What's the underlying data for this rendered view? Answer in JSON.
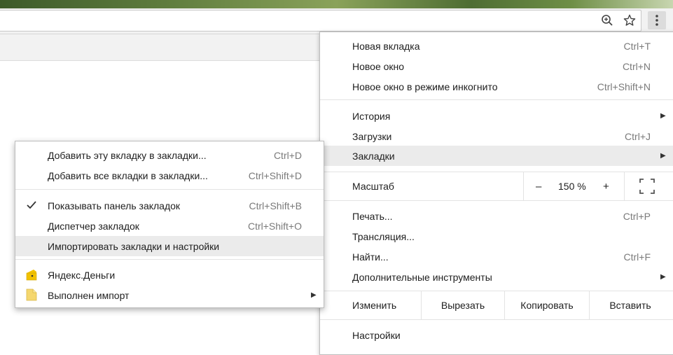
{
  "toolbar": {
    "icons": [
      "zoom-icon",
      "star-icon",
      "kebab-menu-icon"
    ]
  },
  "main_menu": {
    "new_tab": {
      "label": "Новая вкладка",
      "shortcut": "Ctrl+T"
    },
    "new_window": {
      "label": "Новое окно",
      "shortcut": "Ctrl+N"
    },
    "incognito": {
      "label": "Новое окно в режиме инкогнито",
      "shortcut": "Ctrl+Shift+N"
    },
    "history": {
      "label": "История"
    },
    "downloads": {
      "label": "Загрузки",
      "shortcut": "Ctrl+J"
    },
    "bookmarks": {
      "label": "Закладки"
    },
    "zoom": {
      "label": "Масштаб",
      "minus": "–",
      "value": "150 %",
      "plus": "+"
    },
    "print": {
      "label": "Печать...",
      "shortcut": "Ctrl+P"
    },
    "cast": {
      "label": "Трансляция..."
    },
    "find": {
      "label": "Найти...",
      "shortcut": "Ctrl+F"
    },
    "more_tools": {
      "label": "Дополнительные инструменты"
    },
    "edit": {
      "label": "Изменить",
      "cut": "Вырезать",
      "copy": "Копировать",
      "paste": "Вставить"
    },
    "settings": {
      "label": "Настройки"
    }
  },
  "bookmarks_submenu": {
    "add_tab": {
      "label": "Добавить эту вкладку в закладки...",
      "shortcut": "Ctrl+D"
    },
    "add_all": {
      "label": "Добавить все вкладки в закладки...",
      "shortcut": "Ctrl+Shift+D"
    },
    "show_bar": {
      "label": "Показывать панель закладок",
      "shortcut": "Ctrl+Shift+B",
      "checked": true
    },
    "manager": {
      "label": "Диспетчер закладок",
      "shortcut": "Ctrl+Shift+O"
    },
    "import": {
      "label": "Импортировать закладки и настройки"
    },
    "yandex_money": {
      "label": "Яндекс.Деньги"
    },
    "imported": {
      "label": "Выполнен импорт"
    }
  },
  "colors": {
    "highlight": "#ebebeb",
    "separator": "#e3e3e3",
    "shortcut_text": "#7a7a7a",
    "folder_yellow": "#f5d76e",
    "yandex_yellow": "#f2c200"
  }
}
